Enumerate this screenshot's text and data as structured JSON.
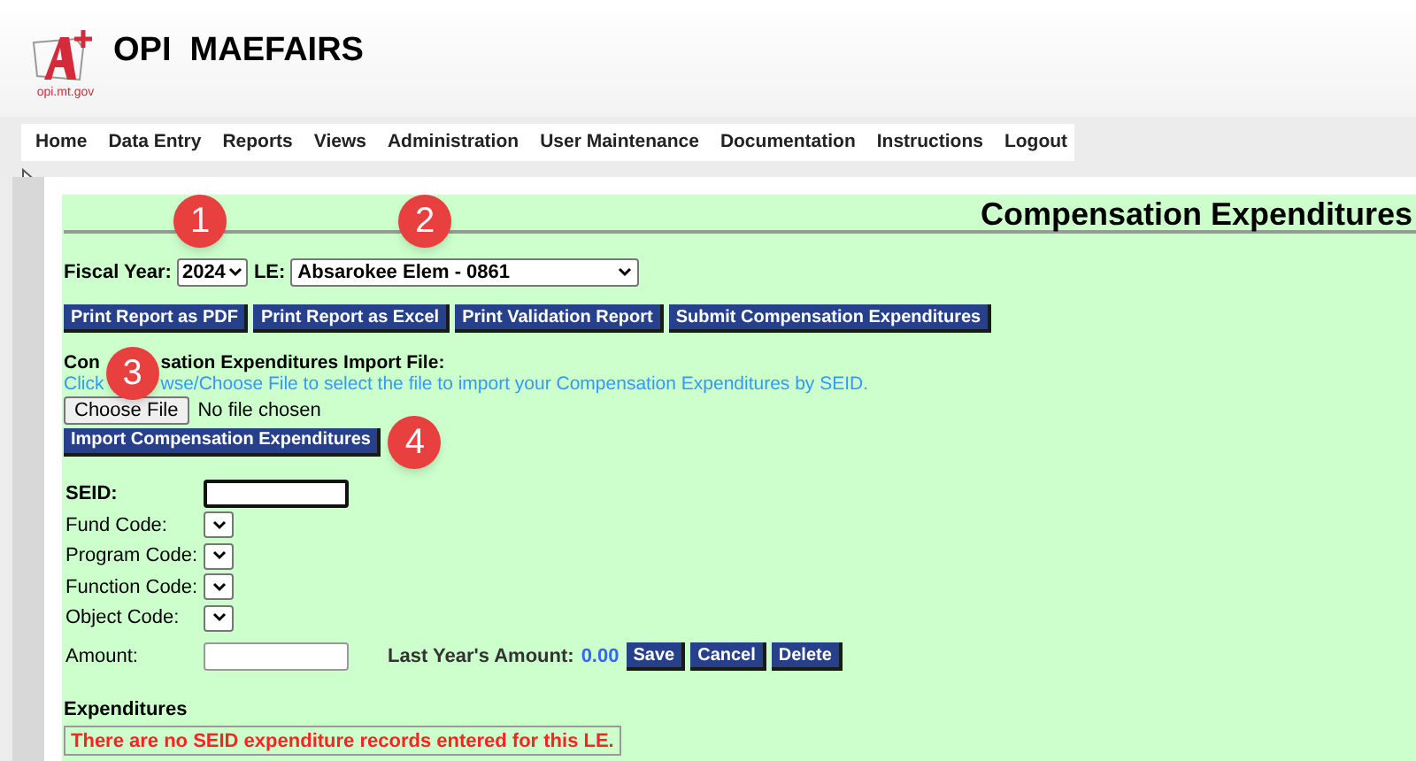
{
  "header": {
    "logo_caption": "opi.mt.gov",
    "title": "OPI  MAEFAIRS"
  },
  "nav": [
    {
      "label": "Home"
    },
    {
      "label": "Data Entry"
    },
    {
      "label": "Reports"
    },
    {
      "label": "Views"
    },
    {
      "label": "Administration"
    },
    {
      "label": "User Maintenance"
    },
    {
      "label": "Documentation"
    },
    {
      "label": "Instructions"
    },
    {
      "label": "Logout"
    }
  ],
  "page_title": "Compensation Expenditures",
  "filters": {
    "fiscal_year_label": "Fiscal Year:",
    "fiscal_year": "2024",
    "le_label": "LE:",
    "le": "Absarokee Elem - 0861"
  },
  "actions": [
    "Print Report as PDF",
    "Print Report as Excel",
    "Print Validation Report",
    "Submit Compensation Expenditures"
  ],
  "import": {
    "label_before": "Con",
    "label_after": "sation Expenditures Import File:",
    "hint_before": "Click",
    "hint_after": "wse/Choose File to select the file to import your Compensation Expenditures by SEID.",
    "choose_button": "Choose File",
    "file_status": "No file chosen",
    "import_button": "Import Compensation Expenditures"
  },
  "form": [
    {
      "kind": "input",
      "label": "SEID:",
      "focused": true
    },
    {
      "kind": "select",
      "label": "Fund Code:"
    },
    {
      "kind": "select",
      "label": "Program Code:"
    },
    {
      "kind": "select",
      "label": "Function Code:"
    },
    {
      "kind": "select",
      "label": "Object Code:"
    },
    {
      "kind": "input",
      "label": "Amount:",
      "focused": false
    }
  ],
  "last_year": {
    "label": "Last Year's Amount:",
    "value": "0.00"
  },
  "form_buttons": [
    "Save",
    "Cancel",
    "Delete"
  ],
  "expenditures": {
    "title": "Expenditures",
    "message": "There are no SEID expenditure records entered for this LE."
  },
  "callouts": [
    "1",
    "2",
    "3",
    "4"
  ]
}
